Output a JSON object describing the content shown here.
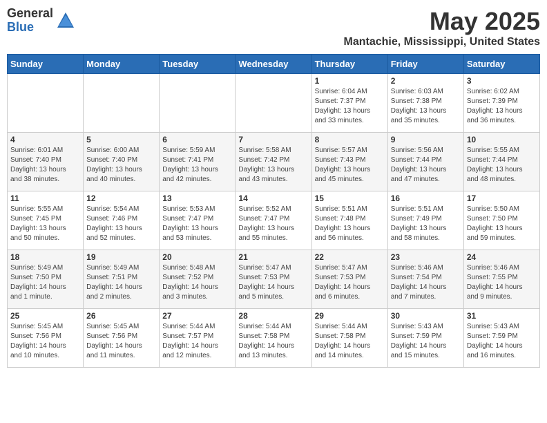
{
  "logo": {
    "general": "General",
    "blue": "Blue"
  },
  "title": "May 2025",
  "location": "Mantachie, Mississippi, United States",
  "days_of_week": [
    "Sunday",
    "Monday",
    "Tuesday",
    "Wednesday",
    "Thursday",
    "Friday",
    "Saturday"
  ],
  "weeks": [
    [
      {
        "day": "",
        "content": ""
      },
      {
        "day": "",
        "content": ""
      },
      {
        "day": "",
        "content": ""
      },
      {
        "day": "",
        "content": ""
      },
      {
        "day": "1",
        "content": "Sunrise: 6:04 AM\nSunset: 7:37 PM\nDaylight: 13 hours\nand 33 minutes."
      },
      {
        "day": "2",
        "content": "Sunrise: 6:03 AM\nSunset: 7:38 PM\nDaylight: 13 hours\nand 35 minutes."
      },
      {
        "day": "3",
        "content": "Sunrise: 6:02 AM\nSunset: 7:39 PM\nDaylight: 13 hours\nand 36 minutes."
      }
    ],
    [
      {
        "day": "4",
        "content": "Sunrise: 6:01 AM\nSunset: 7:40 PM\nDaylight: 13 hours\nand 38 minutes."
      },
      {
        "day": "5",
        "content": "Sunrise: 6:00 AM\nSunset: 7:40 PM\nDaylight: 13 hours\nand 40 minutes."
      },
      {
        "day": "6",
        "content": "Sunrise: 5:59 AM\nSunset: 7:41 PM\nDaylight: 13 hours\nand 42 minutes."
      },
      {
        "day": "7",
        "content": "Sunrise: 5:58 AM\nSunset: 7:42 PM\nDaylight: 13 hours\nand 43 minutes."
      },
      {
        "day": "8",
        "content": "Sunrise: 5:57 AM\nSunset: 7:43 PM\nDaylight: 13 hours\nand 45 minutes."
      },
      {
        "day": "9",
        "content": "Sunrise: 5:56 AM\nSunset: 7:44 PM\nDaylight: 13 hours\nand 47 minutes."
      },
      {
        "day": "10",
        "content": "Sunrise: 5:55 AM\nSunset: 7:44 PM\nDaylight: 13 hours\nand 48 minutes."
      }
    ],
    [
      {
        "day": "11",
        "content": "Sunrise: 5:55 AM\nSunset: 7:45 PM\nDaylight: 13 hours\nand 50 minutes."
      },
      {
        "day": "12",
        "content": "Sunrise: 5:54 AM\nSunset: 7:46 PM\nDaylight: 13 hours\nand 52 minutes."
      },
      {
        "day": "13",
        "content": "Sunrise: 5:53 AM\nSunset: 7:47 PM\nDaylight: 13 hours\nand 53 minutes."
      },
      {
        "day": "14",
        "content": "Sunrise: 5:52 AM\nSunset: 7:47 PM\nDaylight: 13 hours\nand 55 minutes."
      },
      {
        "day": "15",
        "content": "Sunrise: 5:51 AM\nSunset: 7:48 PM\nDaylight: 13 hours\nand 56 minutes."
      },
      {
        "day": "16",
        "content": "Sunrise: 5:51 AM\nSunset: 7:49 PM\nDaylight: 13 hours\nand 58 minutes."
      },
      {
        "day": "17",
        "content": "Sunrise: 5:50 AM\nSunset: 7:50 PM\nDaylight: 13 hours\nand 59 minutes."
      }
    ],
    [
      {
        "day": "18",
        "content": "Sunrise: 5:49 AM\nSunset: 7:50 PM\nDaylight: 14 hours\nand 1 minute."
      },
      {
        "day": "19",
        "content": "Sunrise: 5:49 AM\nSunset: 7:51 PM\nDaylight: 14 hours\nand 2 minutes."
      },
      {
        "day": "20",
        "content": "Sunrise: 5:48 AM\nSunset: 7:52 PM\nDaylight: 14 hours\nand 3 minutes."
      },
      {
        "day": "21",
        "content": "Sunrise: 5:47 AM\nSunset: 7:53 PM\nDaylight: 14 hours\nand 5 minutes."
      },
      {
        "day": "22",
        "content": "Sunrise: 5:47 AM\nSunset: 7:53 PM\nDaylight: 14 hours\nand 6 minutes."
      },
      {
        "day": "23",
        "content": "Sunrise: 5:46 AM\nSunset: 7:54 PM\nDaylight: 14 hours\nand 7 minutes."
      },
      {
        "day": "24",
        "content": "Sunrise: 5:46 AM\nSunset: 7:55 PM\nDaylight: 14 hours\nand 9 minutes."
      }
    ],
    [
      {
        "day": "25",
        "content": "Sunrise: 5:45 AM\nSunset: 7:56 PM\nDaylight: 14 hours\nand 10 minutes."
      },
      {
        "day": "26",
        "content": "Sunrise: 5:45 AM\nSunset: 7:56 PM\nDaylight: 14 hours\nand 11 minutes."
      },
      {
        "day": "27",
        "content": "Sunrise: 5:44 AM\nSunset: 7:57 PM\nDaylight: 14 hours\nand 12 minutes."
      },
      {
        "day": "28",
        "content": "Sunrise: 5:44 AM\nSunset: 7:58 PM\nDaylight: 14 hours\nand 13 minutes."
      },
      {
        "day": "29",
        "content": "Sunrise: 5:44 AM\nSunset: 7:58 PM\nDaylight: 14 hours\nand 14 minutes."
      },
      {
        "day": "30",
        "content": "Sunrise: 5:43 AM\nSunset: 7:59 PM\nDaylight: 14 hours\nand 15 minutes."
      },
      {
        "day": "31",
        "content": "Sunrise: 5:43 AM\nSunset: 7:59 PM\nDaylight: 14 hours\nand 16 minutes."
      }
    ]
  ]
}
